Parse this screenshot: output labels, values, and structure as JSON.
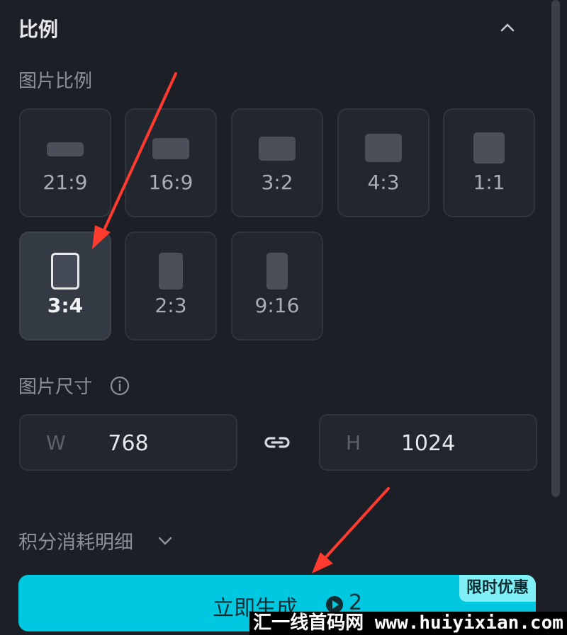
{
  "header": {
    "title": "比例"
  },
  "ratio_section": {
    "label": "图片比例",
    "options": [
      {
        "label": "21:9"
      },
      {
        "label": "16:9"
      },
      {
        "label": "3:2"
      },
      {
        "label": "4:3"
      },
      {
        "label": "1:1"
      },
      {
        "label": "3:4"
      },
      {
        "label": "2:3"
      },
      {
        "label": "9:16"
      }
    ],
    "selected": "3:4"
  },
  "size_section": {
    "label": "图片尺寸",
    "width_prefix": "W",
    "width_value": "768",
    "height_prefix": "H",
    "height_value": "1024"
  },
  "credits": {
    "label": "积分消耗明细"
  },
  "generate": {
    "label": "立即生成",
    "cost": "2",
    "promo_badge": "限时优惠"
  },
  "watermark": {
    "text": "汇一线首码网 www.huiyixian.com"
  },
  "colors": {
    "accent": "#00c8e0",
    "background": "#1c1f26",
    "annotation_arrow": "#ff3b30"
  }
}
